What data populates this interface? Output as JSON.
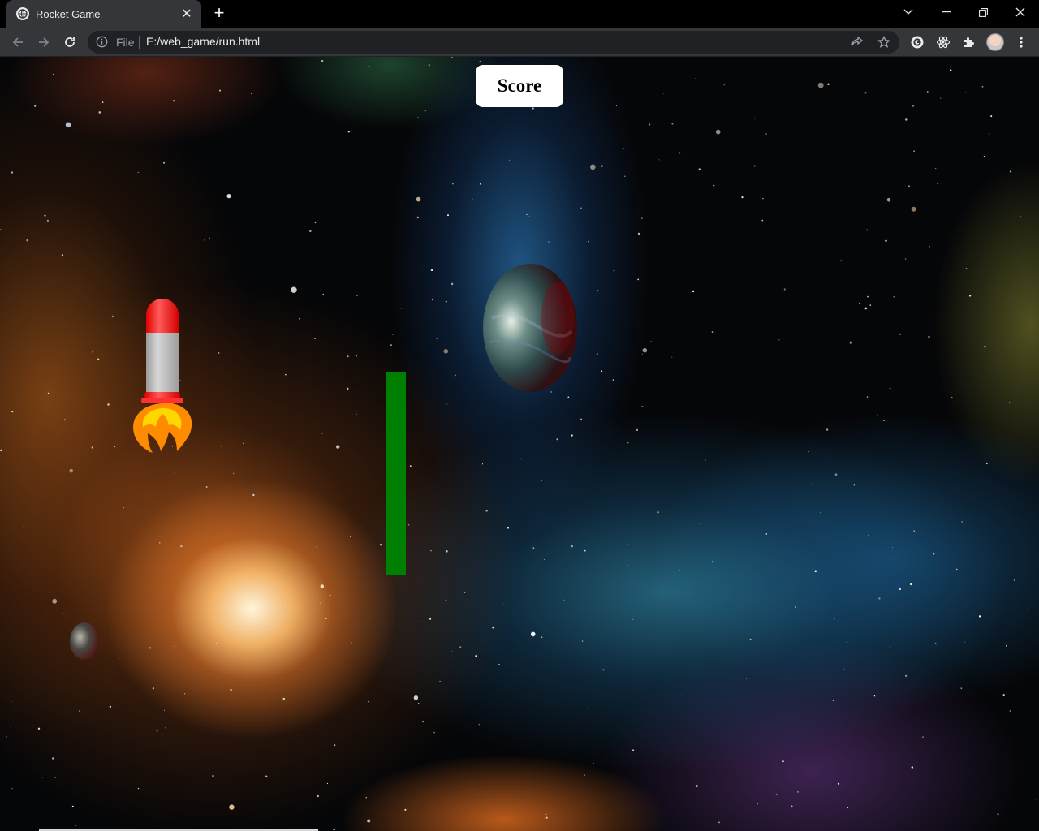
{
  "browser": {
    "tab_title": "Rocket Game",
    "tab_favicon": "globe-icon",
    "address_scheme_label": "File",
    "address_url": "E:/web_game/run.html",
    "theme_color": "#35363a"
  },
  "game": {
    "score_label": "Score",
    "obstacle_color": "#008000",
    "rocket": {
      "nose_color": "#ff2b2b",
      "body_color": "#c4c4c4",
      "flame_outer_color": "#ff8c00",
      "flame_inner_color": "#ffd700"
    },
    "background": "space-nebula"
  }
}
